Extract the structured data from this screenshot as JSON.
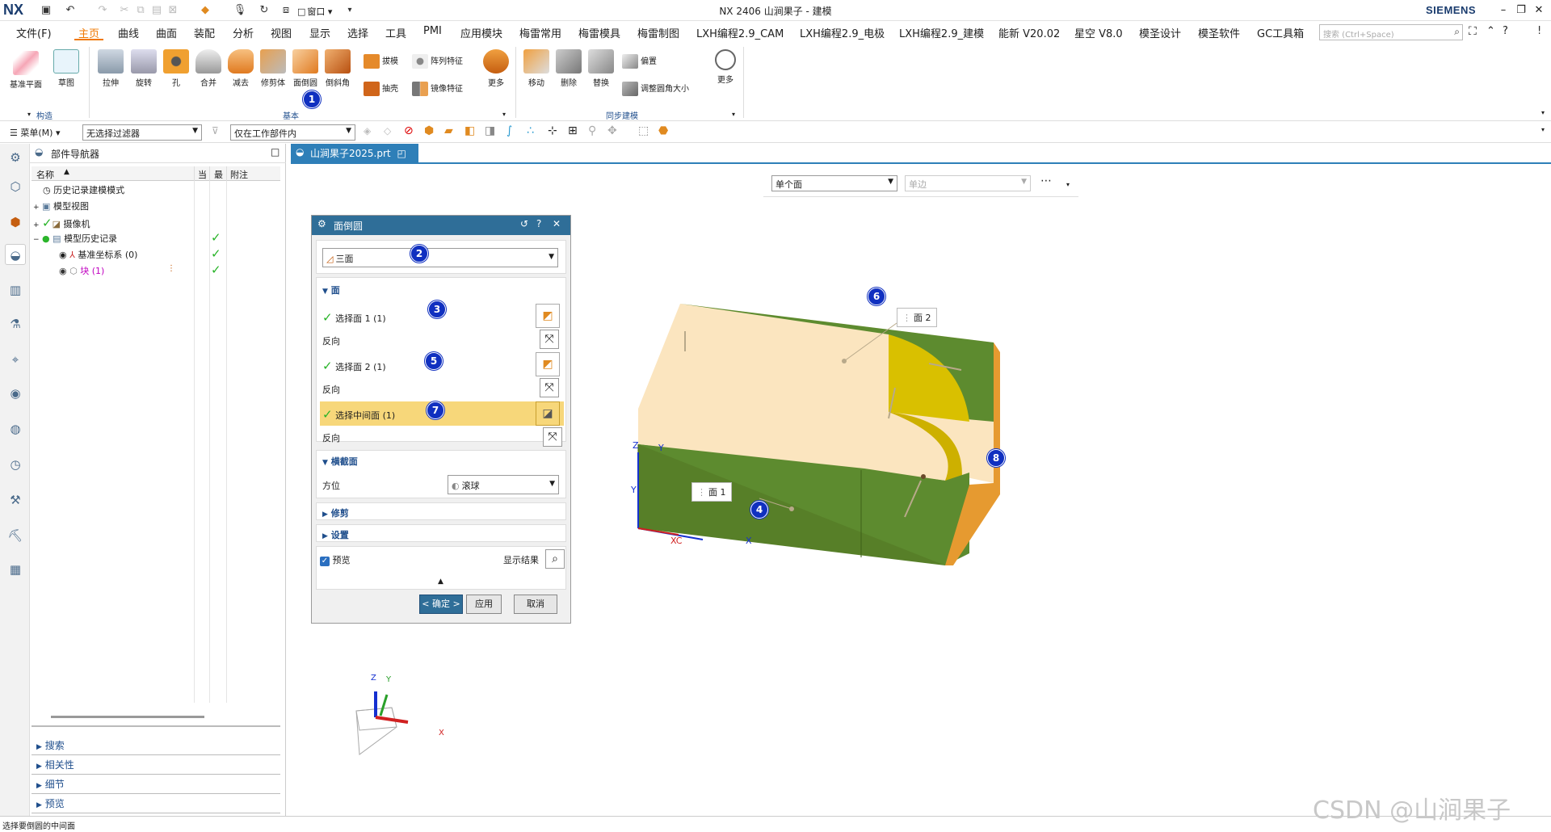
{
  "titlebar": {
    "logo": "NX",
    "title": "NX 2406 山涧果子 - 建模",
    "brand": "SIEMENS",
    "window_menu": "窗口"
  },
  "menubar": {
    "items": [
      "文件(F)",
      "主页",
      "曲线",
      "曲面",
      "装配",
      "分析",
      "视图",
      "显示",
      "选择",
      "工具",
      "PMI",
      "应用模块",
      "梅雷常用",
      "梅雷模具",
      "梅雷制图",
      "LXH编程2.9_CAM",
      "LXH编程2.9_电极",
      "LXH编程2.9_建模",
      "能新 V20.02",
      "星空 V8.0",
      "模圣设计",
      "模圣软件",
      "GC工具箱"
    ],
    "active_index": 1,
    "search_placeholder": "搜索 (Ctrl+Space)"
  },
  "ribbon": {
    "construct": {
      "buttons": [
        "基准平面",
        "草图"
      ],
      "group_label": "构造"
    },
    "basic": {
      "buttons": [
        "拉伸",
        "旋转",
        "孔",
        "合并",
        "减去",
        "修剪体",
        "面倒圆",
        "倒斜角"
      ],
      "small": [
        "拔模",
        "阵列特征",
        "抽壳",
        "镜像特征"
      ],
      "more": "更多",
      "group_label": "基本"
    },
    "sync": {
      "buttons": [
        "移动",
        "删除",
        "替换"
      ],
      "small": [
        "偏置",
        "调整圆角大小"
      ],
      "more": "更多",
      "group_label": "同步建模"
    }
  },
  "toolbar2": {
    "menu": "菜单(M)",
    "filter": "无选择过滤器",
    "scope": "仅在工作部件内"
  },
  "navigator": {
    "title": "部件导航器",
    "columns": [
      "名称",
      "当",
      "最",
      "附注"
    ],
    "rows": [
      {
        "label": "历史记录建模模式",
        "check": false
      },
      {
        "label": "模型视图",
        "check": false
      },
      {
        "label": "摄像机",
        "check": true
      },
      {
        "label": "模型历史记录",
        "check": true
      },
      {
        "label": "基准坐标系 (0)",
        "check": true
      },
      {
        "label": "块 (1)",
        "check": true
      }
    ],
    "panels": [
      "搜索",
      "相关性",
      "细节",
      "预览"
    ]
  },
  "graphics": {
    "tab": "山涧果子2025.prt",
    "select_filter": "单个面",
    "select_mode": "单边",
    "face1": "面 1",
    "face2": "面 2",
    "axis_x": "X",
    "axis_y": "Y",
    "axis_z": "Z",
    "axis_xc": "XC"
  },
  "dialog": {
    "title": "面倒圆",
    "type": "三面",
    "face_section": "面",
    "select1": "选择面 1 (1)",
    "reverse": "反向",
    "select2": "选择面 2 (1)",
    "select_mid": "选择中间面 (1)",
    "cross_section": "横截面",
    "orientation_label": "方位",
    "orientation": "滚球",
    "trim": "修剪",
    "settings": "设置",
    "preview": "预览",
    "show_result": "显示结果",
    "ok": "< 确定 >",
    "apply": "应用",
    "cancel": "取消"
  },
  "badges": [
    "1",
    "2",
    "3",
    "4",
    "5",
    "6",
    "7",
    "8"
  ],
  "status": "选择要倒圆的中间面",
  "watermark": "CSDN @山涧果子",
  "colors": {
    "accent": "#f07800",
    "dialog_header": "#2f6e98",
    "face_green": "#5a8a2a",
    "face_yellow": "#d4b800",
    "face_orange": "#e08a20",
    "face_cream": "#fbe5bf",
    "badge": "#1030c0",
    "highlight_row": "#f7d77a"
  }
}
